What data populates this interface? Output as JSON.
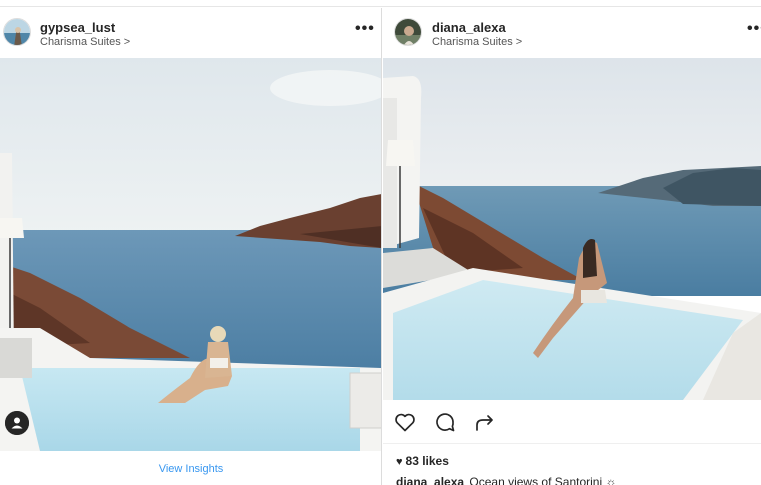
{
  "posts": [
    {
      "username": "gypsea_lust",
      "location": "Charisma Suites",
      "location_chevron": ">",
      "more_label": "•••",
      "insights_label": "View Insights"
    },
    {
      "username": "diana_alexa",
      "location": "Charisma Suites",
      "location_chevron": ">",
      "more_label": "•••",
      "likes": "83 likes",
      "likes_icon": "♥",
      "caption_user": "diana_alexa",
      "caption_text": "Ocean views of Santorini ☼"
    }
  ],
  "icons": {
    "like": "heart-outline-icon",
    "comment": "comment-icon",
    "share": "share-icon",
    "profile": "profile-badge-icon",
    "more": "more-options-icon"
  },
  "colors": {
    "link": "#3897f0",
    "text": "#262626",
    "sea": "#5f8fb0",
    "sky": "#e6ecef",
    "pool": "#bfe2ef",
    "cliff": "#7a4a36"
  }
}
